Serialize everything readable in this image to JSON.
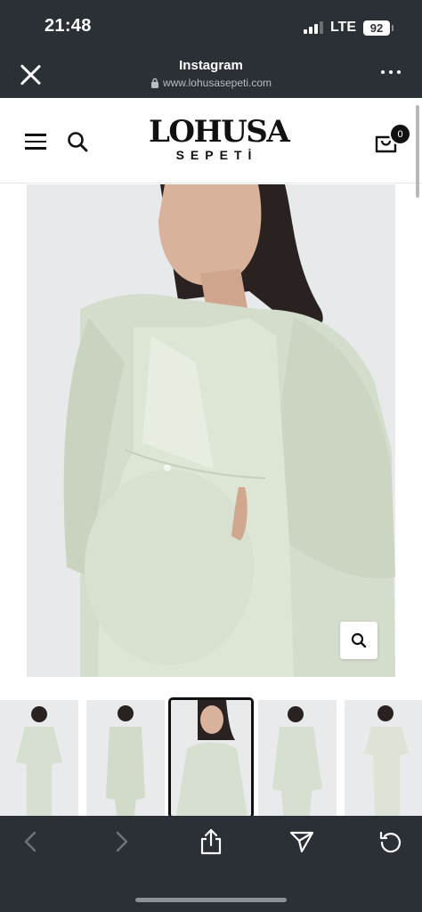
{
  "status_bar": {
    "time": "21:48",
    "network": "LTE",
    "battery": "92"
  },
  "browser": {
    "title": "Instagram",
    "url": "www.lohusasepeti.com"
  },
  "site": {
    "logo_main": "LOHUSA",
    "logo_sub": "SEPETİ",
    "cart_count": "0"
  },
  "icons": {
    "close": "close-icon",
    "more": "more-icon",
    "lock": "lock-icon",
    "menu": "hamburger-menu-icon",
    "search": "search-icon",
    "cart": "shopping-bag-icon",
    "zoom": "zoom-icon",
    "back": "chevron-left-icon",
    "forward": "chevron-right-icon",
    "share": "share-icon",
    "send": "send-icon",
    "reload": "reload-icon"
  },
  "product": {
    "thumbnails": [
      "thumbnail-1",
      "thumbnail-2",
      "thumbnail-3",
      "thumbnail-4",
      "thumbnail-5"
    ],
    "active_thumbnail": 3
  },
  "colors": {
    "chrome": "#2b2f36",
    "garment": "#d7e0cf",
    "accent": "#111111"
  }
}
